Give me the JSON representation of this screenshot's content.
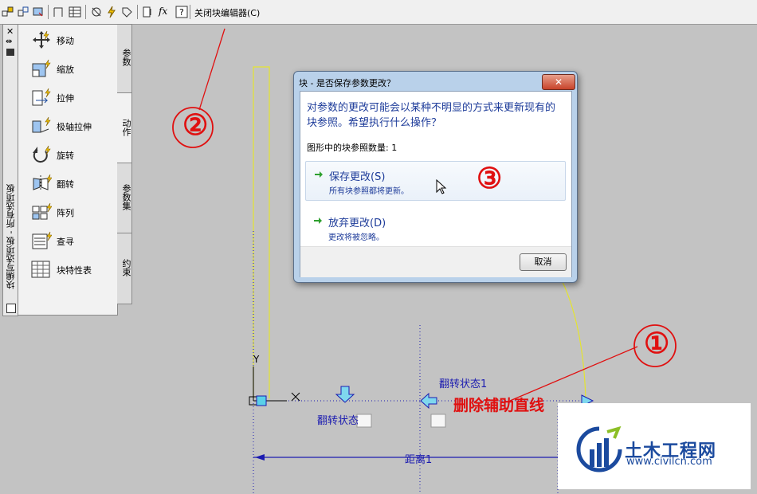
{
  "toolbar": {
    "close_block_editor": "关闭块编辑器(C)"
  },
  "palette": {
    "title": "块编写选项板 - 所有选项板",
    "items": [
      {
        "label": "移动"
      },
      {
        "label": "缩放"
      },
      {
        "label": "拉伸"
      },
      {
        "label": "极轴拉伸"
      },
      {
        "label": "旋转"
      },
      {
        "label": "翻转"
      },
      {
        "label": "阵列"
      },
      {
        "label": "查寻"
      },
      {
        "label": "块特性表"
      }
    ],
    "tabs": [
      "参数",
      "动作",
      "参数集",
      "约束"
    ],
    "active_tab": "动作"
  },
  "dialog": {
    "title": "块 - 是否保存参数更改？",
    "message": "对参数的更改可能会以某种不明显的方式来更新现有的块参照。希望执行什么操作？",
    "ref_count": "图形中的块参照数量: 1",
    "options": [
      {
        "title": "保存更改(S)",
        "subtitle": "所有块参照都将更新。"
      },
      {
        "title": "放弃更改(D)",
        "subtitle": "更改将被忽略。"
      }
    ],
    "cancel": "取消"
  },
  "canvas": {
    "flip_state_1": "翻转状态1",
    "flip_state_2": "翻转状态",
    "distance": "距离1",
    "axis_y": "Y"
  },
  "annotations": {
    "n1": "①",
    "n2": "②",
    "n3": "③",
    "delete_note": "删除辅助直线"
  },
  "watermark": {
    "title": "土木工程网",
    "url": "www.civilcn.com"
  },
  "colors": {
    "annotation_red": "#e01010",
    "dialog_text": "#1e3c9a",
    "cad_blue": "#1b1bb0",
    "aux_line_yellow": "#e4e430"
  }
}
